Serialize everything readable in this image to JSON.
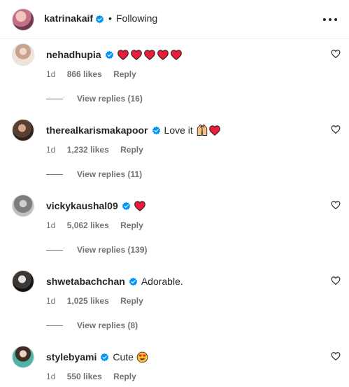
{
  "header": {
    "username": "katrinakaif",
    "separator": "•",
    "follow_status": "Following",
    "more_icon": "more-horizontal-icon"
  },
  "colors": {
    "verified": "#0095f6",
    "heart_red": "#ed1c3a",
    "meta_gray": "#737373",
    "text": "#262626"
  },
  "comments": [
    {
      "username": "nehadhupia",
      "text": "",
      "emoji": "red-heart x5",
      "age": "1d",
      "likes": "866 likes",
      "reply": "Reply",
      "view_replies": "View replies (16)"
    },
    {
      "username": "therealkarismakapoor",
      "text": "Love it",
      "emoji": "hands-raised + red-heart",
      "age": "1d",
      "likes": "1,232 likes",
      "reply": "Reply",
      "view_replies": "View replies (11)"
    },
    {
      "username": "vickykaushal09",
      "text": "",
      "emoji": "red-heart",
      "age": "1d",
      "likes": "5,062 likes",
      "reply": "Reply",
      "view_replies": "View replies (139)"
    },
    {
      "username": "shwetabachchan",
      "text": "Adorable.",
      "emoji": "",
      "age": "1d",
      "likes": "1,025 likes",
      "reply": "Reply",
      "view_replies": "View replies (8)"
    },
    {
      "username": "stylebyami",
      "text": "Cute",
      "emoji": "heart-eyes-face",
      "age": "1d",
      "likes": "550 likes",
      "reply": "Reply",
      "view_replies": ""
    }
  ]
}
